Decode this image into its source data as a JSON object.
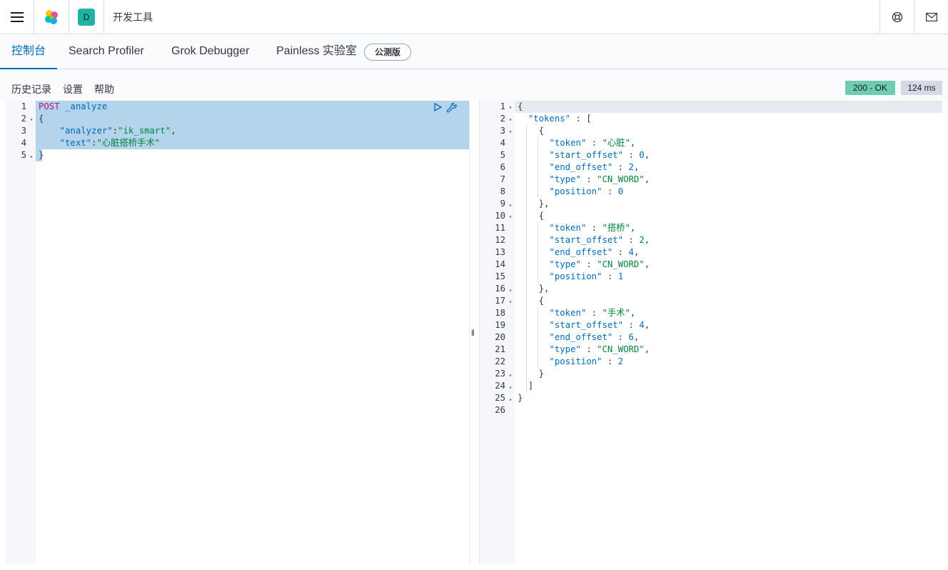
{
  "header": {
    "space_initial": "D",
    "breadcrumb": "开发工具"
  },
  "tabs": [
    {
      "label": "控制台",
      "active": true
    },
    {
      "label": "Search Profiler",
      "active": false
    },
    {
      "label": "Grok Debugger",
      "active": false
    },
    {
      "label": "Painless 实验室",
      "active": false
    }
  ],
  "beta_badge": "公测版",
  "subnav": {
    "history": "历史记录",
    "settings": "设置",
    "help": "帮助"
  },
  "response_status": {
    "code": "200 - OK",
    "time": "124 ms"
  },
  "request_lines": [
    "POST _analyze",
    "{",
    "    \"analyzer\":\"ik_smart\",",
    "    \"text\":\"心脏搭桥手术\"",
    "}"
  ],
  "response_lines": [
    "{",
    "  \"tokens\" : [",
    "    {",
    "      \"token\" : \"心脏\",",
    "      \"start_offset\" : 0,",
    "      \"end_offset\" : 2,",
    "      \"type\" : \"CN_WORD\",",
    "      \"position\" : 0",
    "    },",
    "    {",
    "      \"token\" : \"搭桥\",",
    "      \"start_offset\" : 2,",
    "      \"end_offset\" : 4,",
    "      \"type\" : \"CN_WORD\",",
    "      \"position\" : 1",
    "    },",
    "    {",
    "      \"token\" : \"手术\",",
    "      \"start_offset\" : 4,",
    "      \"end_offset\" : 6,",
    "      \"type\" : \"CN_WORD\",",
    "      \"position\" : 2",
    "    }",
    "  ]",
    "}",
    ""
  ],
  "request_folds": {
    "2": "open",
    "5": "close"
  },
  "response_folds": {
    "1": "open",
    "2": "open",
    "3": "open",
    "9": "close",
    "10": "open",
    "16": "close",
    "17": "open",
    "23": "close",
    "24": "close",
    "25": "close"
  },
  "colors": {
    "accent": "#006bb8",
    "ok": "#6dccb1",
    "selection": "#b3d4ea",
    "space_badge": "#20b3a3"
  },
  "icons": {
    "menu": "hamburger-icon",
    "logo": "elastic-logo-icon",
    "help": "help-lifebuoy-icon",
    "news": "mail-icon",
    "run": "play-icon",
    "wrench": "wrench-icon"
  }
}
